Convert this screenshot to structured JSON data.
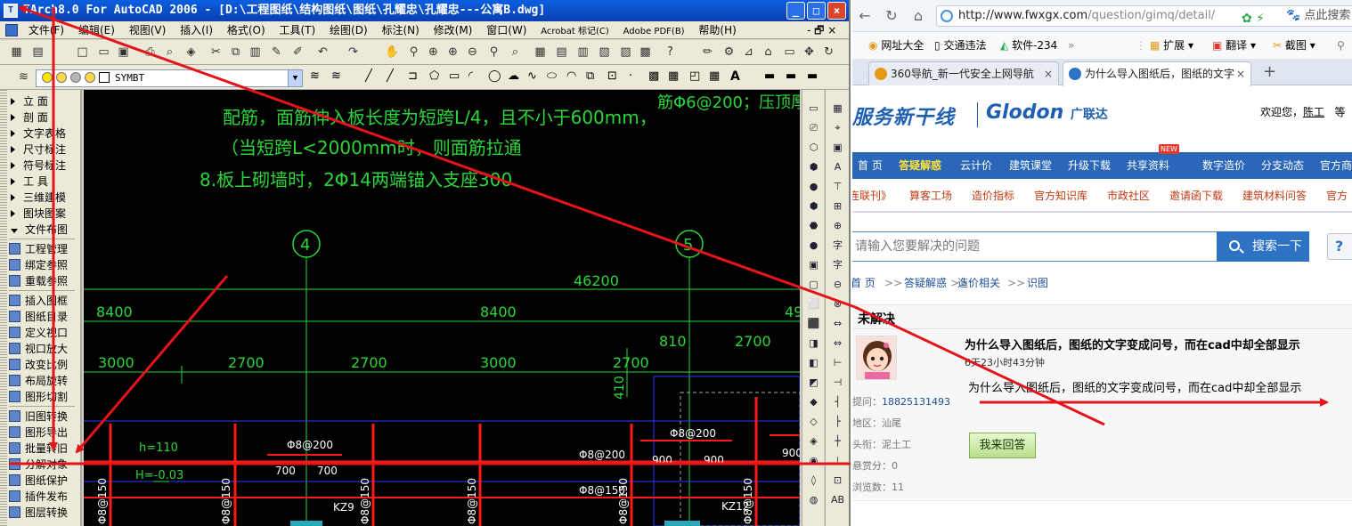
{
  "cad": {
    "title": "TArch8.0 For AutoCAD 2006 - [D:\\工程图纸\\结构图纸\\图纸\\孔耀忠\\孔耀忠---公寓B.dwg]",
    "window_buttons": [
      "_",
      "□",
      "×"
    ],
    "menu": [
      "文件(F)",
      "编辑(E)",
      "视图(V)",
      "插入(I)",
      "格式(O)",
      "工具(T)",
      "绘图(D)",
      "标注(N)",
      "修改(M)",
      "窗口(W)",
      "Acrobat 标记(C)",
      "Adobe PDF(B)",
      "帮助(H)"
    ],
    "menu_right": "- 🗗 ×",
    "layer_combo": "SYMBT",
    "tarch_panel": [
      {
        "label": "立      面",
        "kind": "collapsed"
      },
      {
        "label": "剖      面",
        "kind": "collapsed"
      },
      {
        "label": "文字表格",
        "kind": "collapsed"
      },
      {
        "label": "尺寸标注",
        "kind": "collapsed"
      },
      {
        "label": "符号标注",
        "kind": "collapsed"
      },
      {
        "label": "工      具",
        "kind": "collapsed"
      },
      {
        "label": "三维建模",
        "kind": "collapsed"
      },
      {
        "label": "图块图案",
        "kind": "collapsed"
      },
      {
        "label": "文件布图",
        "kind": "expanded"
      },
      {
        "label": "工程管理",
        "kind": "item"
      },
      {
        "label": "绑定参照",
        "kind": "item"
      },
      {
        "label": "重载参照",
        "kind": "item"
      },
      {
        "label": "插入图框",
        "kind": "item"
      },
      {
        "label": "图纸目录",
        "kind": "item"
      },
      {
        "label": "定义视口",
        "kind": "item"
      },
      {
        "label": "视口放大",
        "kind": "item"
      },
      {
        "label": "改变比例",
        "kind": "item"
      },
      {
        "label": "布局旋转",
        "kind": "item"
      },
      {
        "label": "图形切割",
        "kind": "item"
      },
      {
        "label": "旧图转换",
        "kind": "item"
      },
      {
        "label": "图形导出",
        "kind": "item"
      },
      {
        "label": "批量转旧",
        "kind": "item"
      },
      {
        "label": "分解对象",
        "kind": "item"
      },
      {
        "label": "图纸保护",
        "kind": "item"
      },
      {
        "label": "插件发布",
        "kind": "item"
      },
      {
        "label": "图层转换",
        "kind": "item"
      }
    ],
    "drawing": {
      "note1": "配筋，面筋伸入板长度为短跨L/4，且不小于600mm，",
      "note2": "（当短跨L<2000mm时，则面筋拉通",
      "note3": "8.板上砌墙时，2Φ14两端锚入支座300.",
      "note_right": "筋Φ6@200；压顶厚",
      "axis_4": "4",
      "axis_5": "5",
      "dim_total": "46200",
      "dim_row2": [
        "8400",
        "8400",
        "49"
      ],
      "dim_row3": [
        "3000",
        "2700",
        "2700",
        "3000",
        "2700",
        "810",
        "2700"
      ],
      "dim_410": "410",
      "h_label": "h=110",
      "H_label": "H=-0.03",
      "rebar": [
        "Φ8@200",
        "Φ8@200",
        "Φ8@200",
        "Φ8@150",
        "Φ8@150",
        "Φ8@150",
        "Φ8@150",
        "Φ8@150",
        "Φ8@150",
        "Φ8@150"
      ],
      "dim_700": [
        "700",
        "700"
      ],
      "dim_900": [
        "900",
        "900",
        "900"
      ],
      "col_kz9": "KZ9",
      "col_kz12": "KZ12"
    }
  },
  "browser": {
    "url_host": "http://www.fwxgx.com",
    "url_path": "/question/gimq/detail/",
    "search_hint": "点此搜索",
    "bookmarks": [
      "网址大全",
      "交通违法",
      "软件-234",
      "»",
      "扩展",
      "翻译",
      "截图"
    ],
    "tabs": [
      {
        "label": "360导航_新一代安全上网导航",
        "active": false
      },
      {
        "label": "为什么导入图纸后，图纸的文字",
        "active": true
      }
    ],
    "new_tab": "+",
    "site": {
      "logo_text": "服务新干线",
      "logo_brand": "Glodon",
      "logo_brand_cn": "广联达",
      "welcome": "欢迎您，",
      "user": "陈工",
      "welcome_tail": "等",
      "nav": [
        "首 页",
        "答疑解惑",
        "云计价",
        "建筑课堂",
        "升级下载",
        "共享资料",
        "数字造价",
        "分支动态",
        "官方商"
      ],
      "nav_new_badge": "NEW",
      "subnav": [
        "连联刊》",
        "算客工场",
        "造价指标",
        "官方知识库",
        "市政社区",
        "邀请函下载",
        "建筑材料问答",
        "官方"
      ],
      "search_placeholder": "请输入您要解决的问题",
      "search_button": "搜索一下",
      "help_button": "?",
      "breadcrumb": [
        "首 页",
        "答疑解惑",
        "造价相关",
        "识图"
      ],
      "breadcrumb_sep": ">>",
      "status": "未解决",
      "question_title": "为什么导入图纸后，图纸的文字变成问号，而在cad中却全部显示",
      "question_time": "6天23小时43分钟",
      "question_body": "为什么导入图纸后，图纸的文字变成问号，而在cad中却全部显示",
      "meta": [
        {
          "label": "提问：",
          "value": "18825131493"
        },
        {
          "label": "地区：",
          "value": "汕尾"
        },
        {
          "label": "头衔：",
          "value": "泥土工"
        },
        {
          "label": "悬赏分：",
          "value": "0"
        },
        {
          "label": "浏览数：",
          "value": "11"
        }
      ],
      "answer_button": "我来回答"
    }
  },
  "colors": {
    "cad_bg": "#000000",
    "cad_text": "#2bd63a",
    "rebar_red": "#ff1a1a",
    "arrow_red": "#e5141b",
    "xp_title": "#0a3fb0",
    "site_blue": "#2a67b8"
  }
}
